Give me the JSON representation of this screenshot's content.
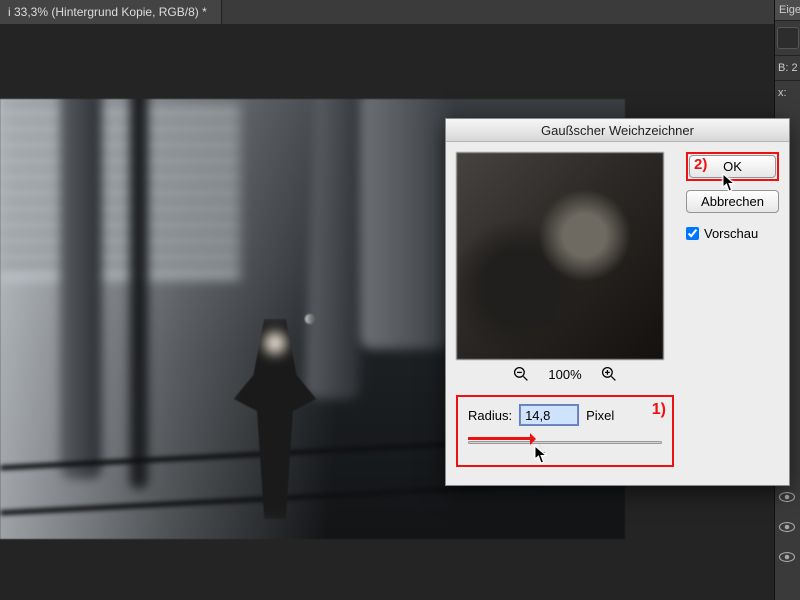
{
  "doc_tab": {
    "title": "i 33,3% (Hintergrund Kopie, RGB/8) *"
  },
  "right_panel": {
    "header": "Eige",
    "info_b": "B:  2",
    "info_x": "x:"
  },
  "dialog": {
    "title": "Gaußscher Weichzeichner",
    "zoom_percent": "100%",
    "radius_label": "Radius:",
    "radius_value": "14,8",
    "radius_unit": "Pixel",
    "ok_label": "OK",
    "cancel_label": "Abbrechen",
    "preview_label": "Vorschau",
    "preview_checked": true,
    "slider_fraction": 0.37,
    "annot_radius": "1)",
    "annot_ok": "2)"
  },
  "icons": {
    "zoom_out": "zoom-out-icon",
    "zoom_in": "zoom-in-icon",
    "eye": "eye-icon",
    "panel": "panel-icon",
    "cursor": "cursor-icon"
  }
}
